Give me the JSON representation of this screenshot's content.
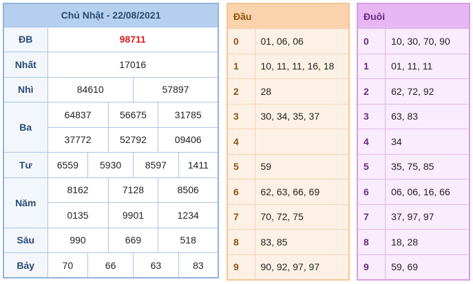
{
  "results": {
    "title": "Chủ Nhật - 22/08/2021",
    "labels": {
      "db": "ĐB",
      "nhat": "Nhất",
      "nhi": "Nhì",
      "ba": "Ba",
      "tu": "Tư",
      "nam": "Năm",
      "sau": "Sáu",
      "bay": "Bảy"
    },
    "db": "98711",
    "nhat": "17016",
    "nhi": [
      "84610",
      "57897"
    ],
    "ba": [
      "64837",
      "56675",
      "31785",
      "37772",
      "52792",
      "09406"
    ],
    "tu": [
      "6559",
      "5930",
      "8597",
      "1411"
    ],
    "nam": [
      "8162",
      "7128",
      "8506",
      "0135",
      "9901",
      "1234"
    ],
    "sau": [
      "990",
      "669",
      "518"
    ],
    "bay": [
      "70",
      "66",
      "63",
      "83"
    ]
  },
  "dau": {
    "header": "Đầu",
    "rows": [
      {
        "key": "0",
        "values": "01, 06, 06"
      },
      {
        "key": "1",
        "values": "10, 11, 11, 16, 18"
      },
      {
        "key": "2",
        "values": "28"
      },
      {
        "key": "3",
        "values": "30, 34, 35, 37"
      },
      {
        "key": "4",
        "values": ""
      },
      {
        "key": "5",
        "values": "59"
      },
      {
        "key": "6",
        "values": "62, 63, 66, 69"
      },
      {
        "key": "7",
        "values": "70, 72, 75"
      },
      {
        "key": "8",
        "values": "83, 85"
      },
      {
        "key": "9",
        "values": "90, 92, 97, 97"
      }
    ]
  },
  "duoi": {
    "header": "Đuôi",
    "rows": [
      {
        "key": "0",
        "values": "10, 30, 70, 90"
      },
      {
        "key": "1",
        "values": "01, 11, 11"
      },
      {
        "key": "2",
        "values": "62, 72, 92"
      },
      {
        "key": "3",
        "values": "63, 83"
      },
      {
        "key": "4",
        "values": "34"
      },
      {
        "key": "5",
        "values": "35, 75, 85"
      },
      {
        "key": "6",
        "values": "06, 06, 16, 66"
      },
      {
        "key": "7",
        "values": "37, 97, 97"
      },
      {
        "key": "8",
        "values": "18, 28"
      },
      {
        "key": "9",
        "values": "59, 69"
      }
    ]
  },
  "colors": {
    "special": "#e01a1a",
    "blue_header": "#b6cfee",
    "orange_header": "#fbd3ac",
    "purple_header": "#e7b7f3"
  }
}
